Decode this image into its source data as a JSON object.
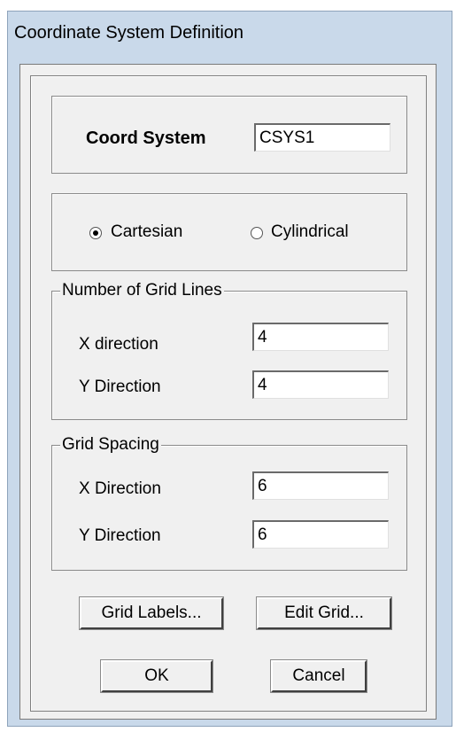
{
  "window": {
    "title": "Coordinate System Definition"
  },
  "coord_system": {
    "label": "Coord System",
    "value": "CSYS1"
  },
  "system_type": {
    "options": [
      {
        "label": "Cartesian",
        "selected": true
      },
      {
        "label": "Cylindrical",
        "selected": false
      }
    ]
  },
  "grid_lines": {
    "legend": "Number of Grid Lines",
    "x_label": "X direction",
    "x_value": "4",
    "y_label": "Y Direction",
    "y_value": "4"
  },
  "grid_spacing": {
    "legend": "Grid Spacing",
    "x_label": "X Direction",
    "x_value": "6",
    "y_label": "Y Direction",
    "y_value": "6"
  },
  "buttons": {
    "grid_labels": "Grid Labels...",
    "edit_grid": "Edit Grid...",
    "ok": "OK",
    "cancel": "Cancel"
  }
}
